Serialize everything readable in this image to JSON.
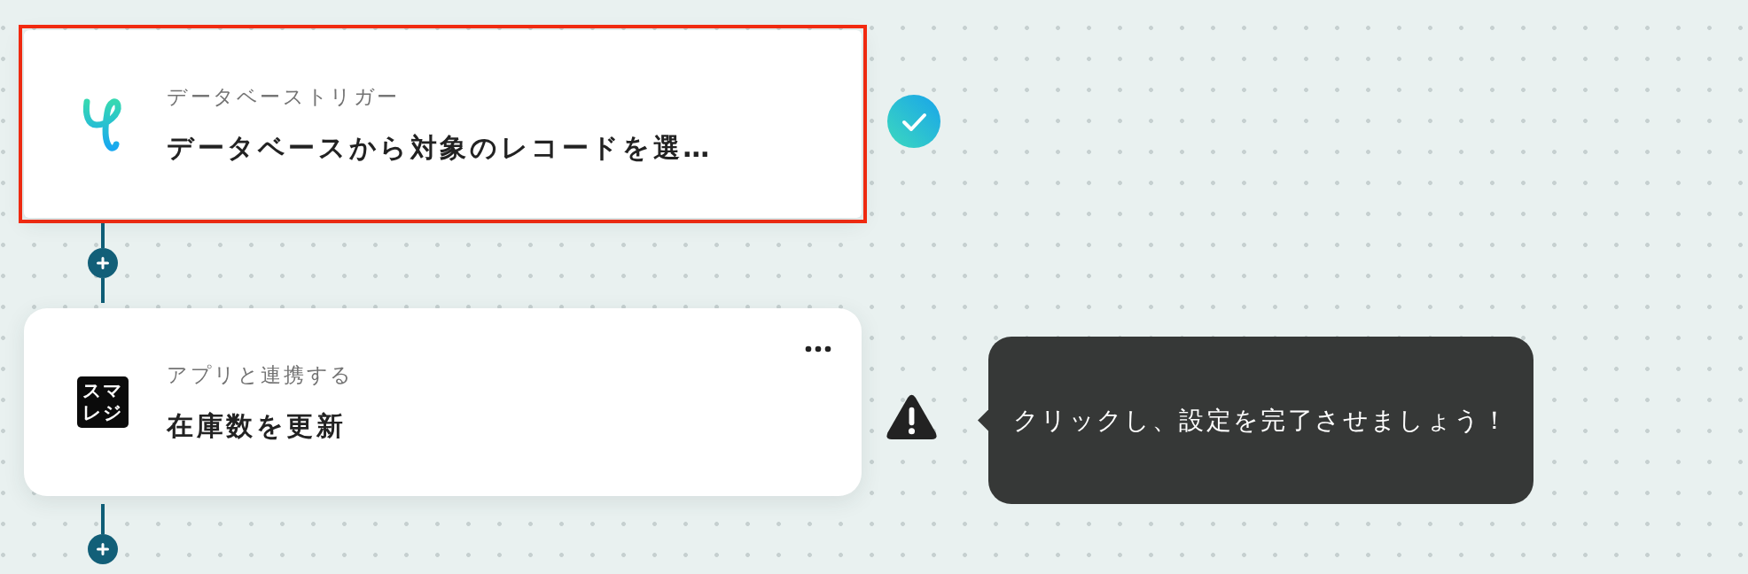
{
  "steps": [
    {
      "kind": "trigger",
      "selected": true,
      "completed": true,
      "category": "データベーストリガー",
      "title": "データベースから対象のレコードを選…",
      "has_menu": false
    },
    {
      "kind": "app",
      "selected": false,
      "completed": false,
      "logo_text": [
        "スマ",
        "レジ"
      ],
      "category": "アプリと連携する",
      "title": "在庫数を更新",
      "has_menu": true,
      "tooltip": "クリックし、設定を完了させましょう！"
    }
  ]
}
